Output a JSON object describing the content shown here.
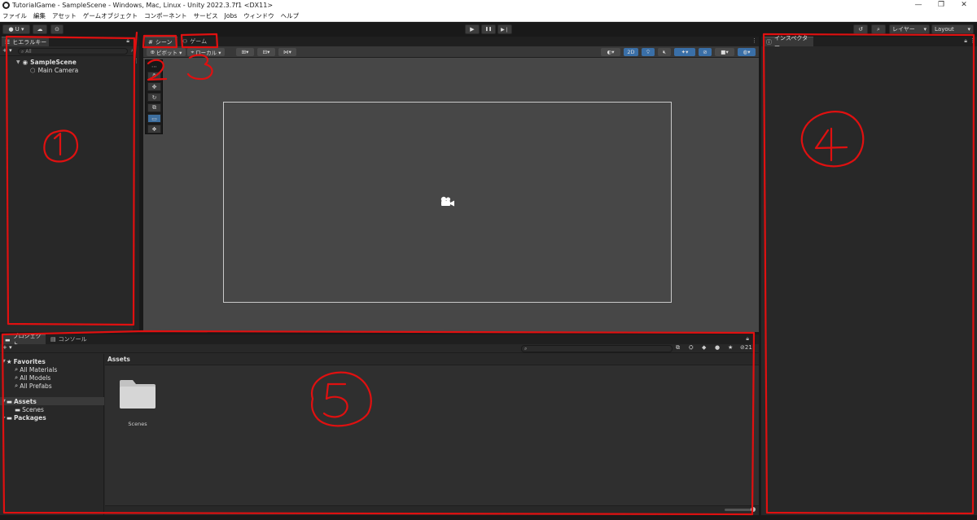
{
  "window": {
    "title": "TutorialGame - SampleScene - Windows, Mac, Linux - Unity 2022.3.7f1 <DX11>",
    "minimize_glyph": "—",
    "maximize_glyph": "❐",
    "close_glyph": "✕"
  },
  "menu": [
    "ファイル",
    "編集",
    "アセット",
    "ゲームオブジェクト",
    "コンポーネント",
    "サービス",
    "Jobs",
    "ウィンドウ",
    "ヘルプ"
  ],
  "toolbar": {
    "account_label": "U ▾",
    "play_glyph": "▶",
    "pause_glyph": "❚❚",
    "step_glyph": "▶❘",
    "layers_label": "レイヤー",
    "layout_label": "Layout"
  },
  "hierarchy": {
    "tab_label": "ヒエラルキー",
    "add_label": "+ ▾",
    "search_placeholder": "All",
    "scene_name": "SampleScene",
    "items": [
      "Main Camera"
    ]
  },
  "scene": {
    "scene_tab": "シーン",
    "game_tab": "ゲーム",
    "pivot_label": "ピボット ▾",
    "local_label": "ローカル ▾",
    "btn_2d": "2D"
  },
  "inspector": {
    "tab_label": "インスペクター"
  },
  "project": {
    "project_tab": "プロジェクト",
    "console_tab": "コンソール",
    "add_label": "+ ▾",
    "favorites_label": "Favorites",
    "favorites": [
      "All Materials",
      "All Models",
      "All Prefabs"
    ],
    "assets_label": "Assets",
    "assets_children": [
      "Scenes"
    ],
    "packages_label": "Packages",
    "breadcrumb": "Assets",
    "folder_name": "Scenes",
    "hidden_count": "21"
  },
  "annotations": {
    "color": "#e01010",
    "labels": [
      "①",
      "2",
      "3",
      "4",
      "5"
    ]
  }
}
